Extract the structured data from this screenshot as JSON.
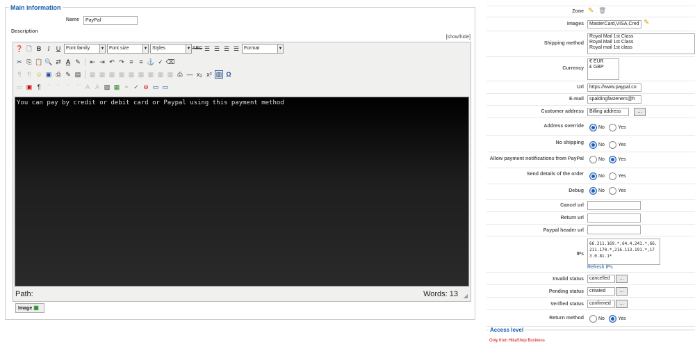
{
  "main": {
    "legend": "Main information",
    "name_label": "Name",
    "name_value": "PayPal",
    "description_label": "Description",
    "show_hide": "[show/hide]",
    "toolbar": {
      "font_family": "Font family",
      "font_size": "Font size",
      "styles": "Styles",
      "format": "Format"
    },
    "editor_content": "You can pay by credit or debit card or Paypal using this payment method",
    "path_label": "Path:",
    "words_label": "Words: 13",
    "image_button": "Image"
  },
  "right": {
    "zone_label": "Zone",
    "images_label": "Images",
    "images_value": "MasterCard,VISA,Cred",
    "shipping_label": "Shipping method",
    "shipping_options": [
      "Royal Mail 1st Class",
      "Royal Mail 1st Class",
      "Royal mail 1st class"
    ],
    "currency_label": "Currency",
    "currency_options": [
      "€ EUR",
      "£ GBP"
    ],
    "url_label": "Url",
    "url_value": "https://www.paypal.co",
    "email_label": "E-mail",
    "email_value": "spaldingfasteners@h",
    "customer_address_label": "Customer address",
    "customer_address_value": "Billing address",
    "address_override_label": "Address override",
    "no_shipping_label": "No shipping",
    "allow_notifications_label": "Allow payment notifications from PayPal",
    "send_details_label": "Send details of the order",
    "debug_label": "Debug",
    "cancel_url_label": "Cancel url",
    "return_url_label": "Return url",
    "paypal_header_url_label": "Paypal header url",
    "ips_label": "IPs",
    "ips_value": "66.211.169.*,64.4.241.*,66.211.170.*,216.113.191.*,173.0.81.1*",
    "refresh_ips": "Refresh IPs",
    "invalid_status_label": "Invalid status",
    "invalid_status_value": "cancelled",
    "pending_status_label": "Pending status",
    "pending_status_value": "created",
    "verified_status_label": "Verified status",
    "verified_status_value": "confirmed",
    "return_method_label": "Return method",
    "no": "No",
    "yes": "Yes",
    "dots": "...",
    "access_legend": "Access level",
    "access_text": "Only from HikaShop Business"
  },
  "colors": {
    "legend": "#135cae",
    "radio_on": "#1a5fb4",
    "access_text": "#cc0000"
  }
}
